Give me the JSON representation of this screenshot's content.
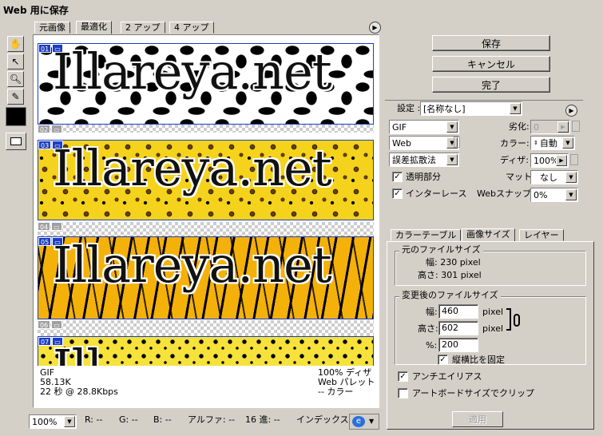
{
  "window": {
    "title": "Web 用に保存"
  },
  "preview_tabs": [
    {
      "label": "元画像"
    },
    {
      "label": "最適化"
    },
    {
      "label": "2 アップ"
    },
    {
      "label": "4 アップ"
    }
  ],
  "slices": {
    "s01": {
      "num": "01",
      "text": "Illareya.net"
    },
    "s02": {
      "num": "02"
    },
    "s03": {
      "num": "03",
      "text": "Illareya.net"
    },
    "s04": {
      "num": "04"
    },
    "s05": {
      "num": "05",
      "text": "Illareya.net"
    },
    "s06": {
      "num": "06"
    },
    "s07": {
      "num": "07",
      "text": "Ill"
    }
  },
  "preview_info": {
    "format": "GIF",
    "size": "58.13K",
    "time": "22 秒 @ 28.8Kbps",
    "dither": "100% ディザ",
    "palette": "Web パレット",
    "colors": "-- カラー"
  },
  "status_bar": {
    "zoom": "100%",
    "r": "R:  --",
    "g": "G:  --",
    "b": "B:  --",
    "alpha": "アルファ:  --",
    "hex": "16 進:  --",
    "index": "インデックス:"
  },
  "buttons": {
    "save": "保存",
    "cancel": "キャンセル",
    "done": "完了"
  },
  "settings": {
    "label": "設定 :",
    "preset": "[名称なし]",
    "format": "GIF",
    "lossy_label": "劣化:",
    "lossy_value": "0",
    "palette": "Web",
    "colors_label": "カラー:",
    "colors_value": "自動",
    "dither_algo": "誤差拡散法",
    "dither_label": "ディザ:",
    "dither_value": "100%",
    "transparency_label": "透明部分",
    "transparency_checked": true,
    "matte_label": "マット:",
    "matte_value": "なし",
    "interlace_label": "インターレース",
    "interlace_checked": true,
    "websnap_label": "Webスナップ:",
    "websnap_value": "0%"
  },
  "settings_tabs": [
    {
      "label": "カラーテーブル"
    },
    {
      "label": "画像サイズ"
    },
    {
      "label": "レイヤー"
    }
  ],
  "image_size": {
    "original_legend": "元のファイルサイズ",
    "orig_width": "幅: 230 pixel",
    "orig_height": "高さ: 301 pixel",
    "new_legend": "変更後のファイルサイズ",
    "width_label": "幅:",
    "width_value": "460",
    "height_label": "高さ:",
    "height_value": "602",
    "unit": "pixel",
    "percent_label": "%:",
    "percent_value": "200",
    "constrain_label": "縦横比を固定",
    "constrain_checked": true,
    "antialias_label": "アンチエイリアス",
    "antialias_checked": true,
    "clip_label": "アートボードサイズでクリップ",
    "clip_checked": false,
    "apply_label": "適用"
  },
  "colors": {
    "slice_tag": "#1c3ec0",
    "face": "#d4d0c8"
  }
}
